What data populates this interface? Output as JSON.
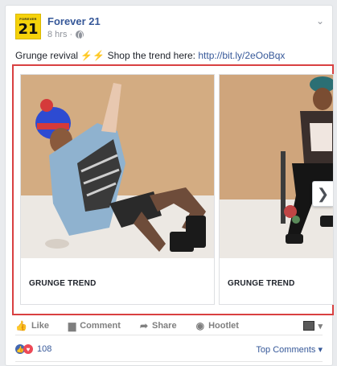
{
  "page": {
    "name": "Forever 21",
    "logo_small": "FOREVER",
    "logo_big": "21",
    "time": "8 hrs ·",
    "icons": {
      "globe": "globe-icon",
      "menu": "chevron-down-icon"
    }
  },
  "post": {
    "text_before": "Grunge revival ",
    "text_mid": " Shop the trend here: ",
    "link": "http://bit.ly/2eOoBqx",
    "emoji": "⚡⚡"
  },
  "carousel": {
    "cards": [
      {
        "title": "GRUNGE TREND"
      },
      {
        "title": "GRUNGE TREND"
      }
    ],
    "next_glyph": "❯"
  },
  "actions": [
    {
      "label": "Like",
      "icon": "thumbs-up-icon",
      "glyph": "👍"
    },
    {
      "label": "Comment",
      "icon": "comment-icon",
      "glyph": "💬"
    },
    {
      "label": "Share",
      "icon": "share-icon",
      "glyph": "➦"
    },
    {
      "label": "Hootlet",
      "icon": "hootlet-icon",
      "glyph": "◉"
    }
  ],
  "reactions": {
    "count": "108",
    "sort_label": "Top Comments",
    "sort_glyph": "▾",
    "colors": {
      "like": "#4267b2",
      "love": "#ed4956"
    }
  }
}
